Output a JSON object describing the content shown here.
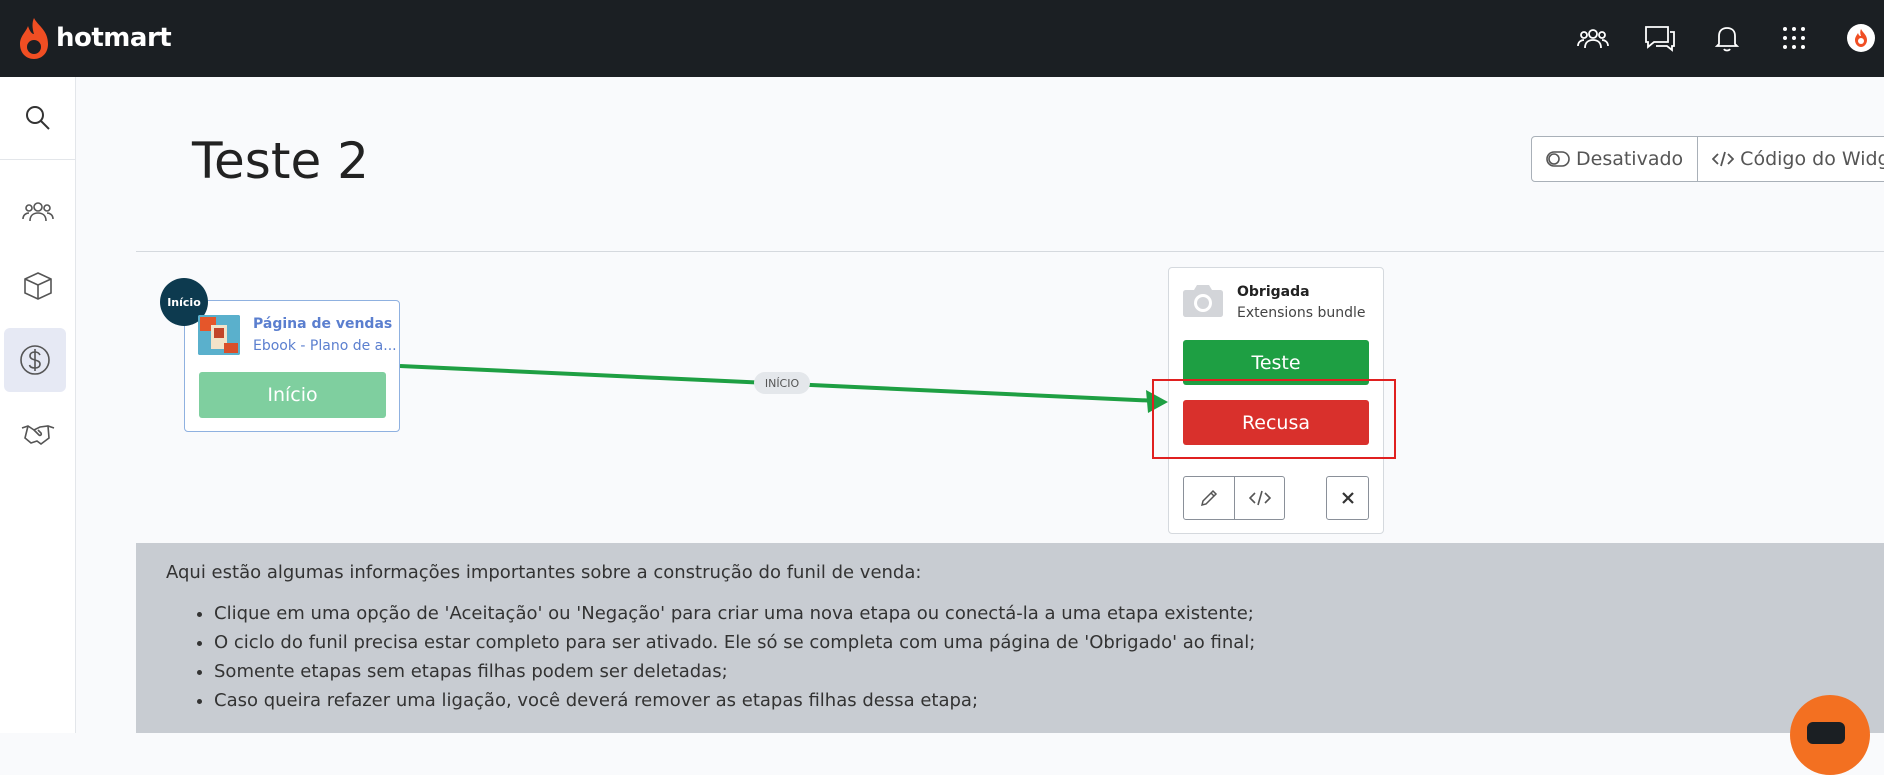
{
  "app": {
    "logo_text": "hotmart"
  },
  "page": {
    "title": "Teste 2"
  },
  "header_actions": {
    "toggle_label": "Desativado",
    "widget_label": "Código do Widget"
  },
  "flow": {
    "start_badge": "Início",
    "sales_node": {
      "title": "Página de vendas",
      "subtitle": "Ebook - Plano de a...",
      "button": "Início"
    },
    "edge_label": "INÍCIO",
    "thanks_node": {
      "title": "Obrigada",
      "subtitle": "Extensions bundle",
      "accept_button": "Teste",
      "reject_button": "Recusa"
    }
  },
  "info": {
    "intro": "Aqui estão algumas informações importantes sobre a construção do funil de venda:",
    "items": [
      "Clique em uma opção de 'Aceitação' ou 'Negação' para criar uma nova etapa ou conectá-la a uma etapa existente;",
      "O ciclo do funil precisa estar completo para ser ativado. Ele só se completa com uma página de 'Obrigado' ao final;",
      "Somente etapas sem etapas filhas podem ser deletadas;",
      "Caso queira refazer uma ligação, você deverá remover as etapas filhas dessa etapa;"
    ]
  },
  "colors": {
    "topbar": "#1b1f23",
    "accept": "#1e9f43",
    "reject": "#d9302c",
    "start_button": "#7fcf9f",
    "brand": "#f37021",
    "highlight": "#e02020"
  },
  "icons": [
    "hotmart-flame-icon",
    "users-icon",
    "chat-icon",
    "bell-icon",
    "apps-grid-icon",
    "profile-icon",
    "search-icon",
    "box-icon",
    "dollar-icon",
    "handshake-icon",
    "toggle-icon",
    "code-icon",
    "camera-icon",
    "pencil-icon",
    "close-icon"
  ]
}
